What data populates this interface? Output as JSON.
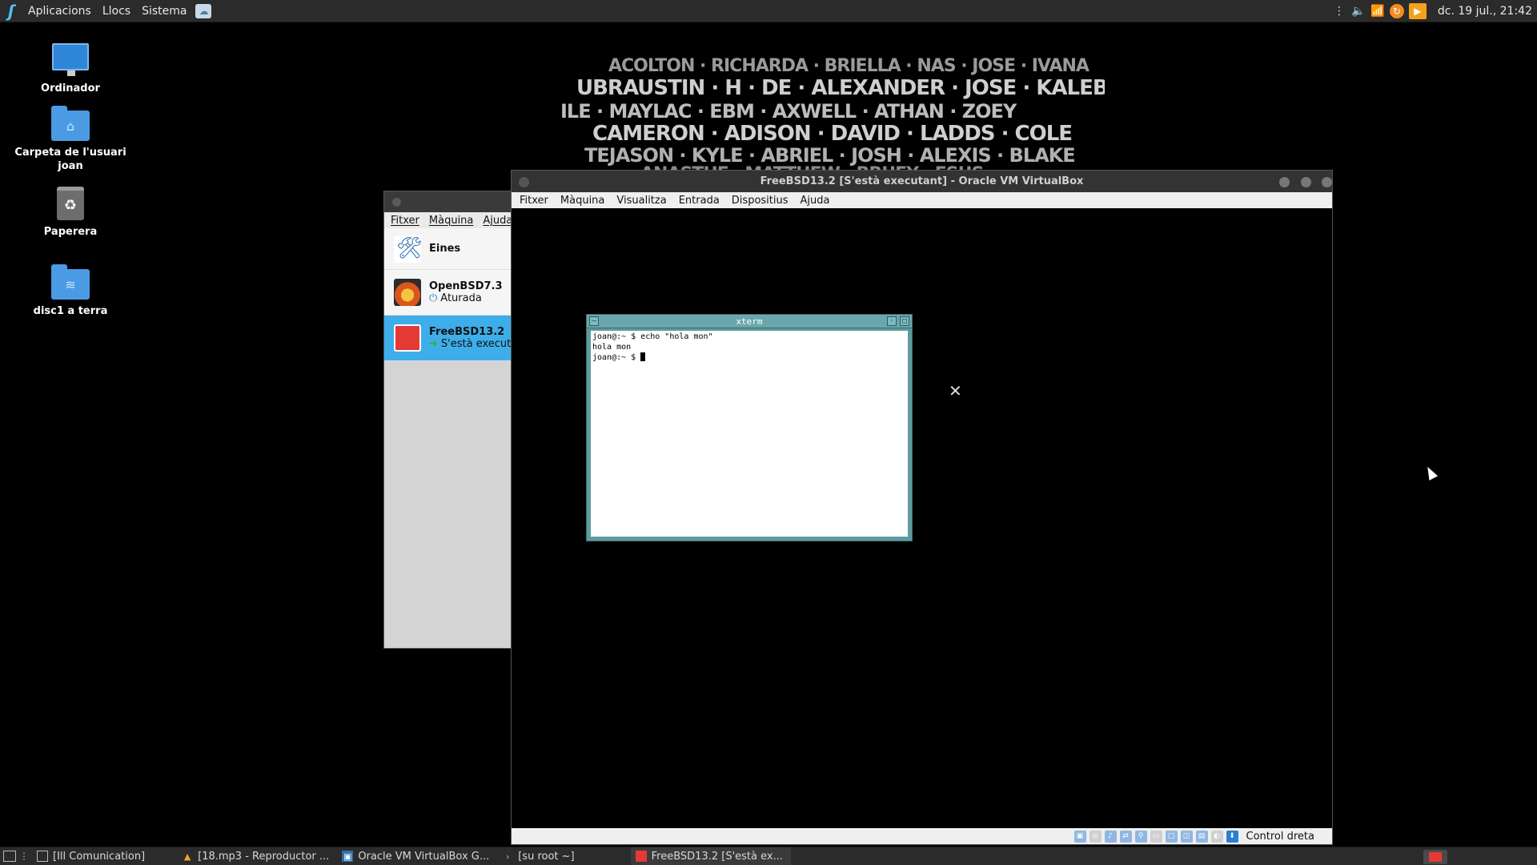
{
  "top_panel": {
    "menus": [
      "Aplicacions",
      "Llocs",
      "Sistema"
    ],
    "clock": "dc. 19 jul., 21:42"
  },
  "desktop_icons": [
    {
      "label": "Ordinador"
    },
    {
      "label": "Carpeta de l'usuari joan"
    },
    {
      "label": "Paperera"
    },
    {
      "label": "disc1 a terra"
    }
  ],
  "vbox_manager": {
    "menus": [
      "Fitxer",
      "Màquina",
      "Ajuda"
    ],
    "tools_label": "Eines",
    "vms": [
      {
        "name": "OpenBSD7.3",
        "state": "Aturada",
        "selected": false
      },
      {
        "name": "FreeBSD13.2",
        "state": "S'està execut",
        "selected": true
      }
    ]
  },
  "vm_window": {
    "title": "FreeBSD13.2 [S'està executant] - Oracle VM VirtualBox",
    "menus": [
      "Fitxer",
      "Màquina",
      "Visualitza",
      "Entrada",
      "Dispositius",
      "Ajuda"
    ],
    "host_key": "Control dreta"
  },
  "xterm": {
    "title": "xterm",
    "lines": [
      "joan@:~ $ echo \"hola mon\"",
      "hola mon",
      "joan@:~ $ "
    ]
  },
  "taskbar": {
    "items": [
      {
        "label": "[Ill Comunication]",
        "icon": "folder-icon"
      },
      {
        "label": "[18.mp3 - Reproductor ...",
        "icon": "vlc-icon"
      },
      {
        "label": "Oracle VM VirtualBox G...",
        "icon": "virtualbox-icon"
      },
      {
        "label": "[su root ~]",
        "icon": "terminal-icon"
      },
      {
        "label": "FreeBSD13.2 [S'està ex...",
        "icon": "freebsd-icon"
      }
    ]
  },
  "colors": {
    "accent_selected": "#3daee9",
    "panel_bg": "#2b2b2b",
    "xterm_frame": "#5f9a9f"
  }
}
